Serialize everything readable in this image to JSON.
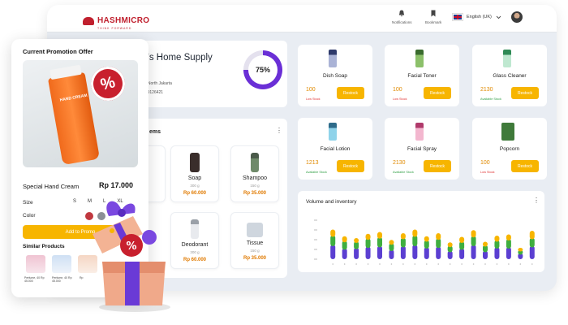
{
  "brand": {
    "name": "HASHMICRO",
    "tagline": "THINK FORWARD"
  },
  "topbar": {
    "notifications_label": "Notifications",
    "bookmark_label": "Bookmark",
    "language": "English (UK)"
  },
  "store": {
    "title": "Retailer's Home Supply Store",
    "address": "Jl. Pegasan, North Jakarta",
    "total_stock": "Total Stock : 9126421",
    "progress_label": "75%",
    "progress_fraction": 0.75,
    "ring_color": "#6a2fd6"
  },
  "products_panel": {
    "heading": "ems",
    "items": [
      {
        "name": "",
        "weight": "",
        "price": ""
      },
      {
        "name": "Soap",
        "weight": "300 g",
        "price": "Rp 60.000"
      },
      {
        "name": "Shampoo",
        "weight": "150 g",
        "price": "Rp 35.000"
      },
      {
        "name": "",
        "weight": "",
        "price": ""
      },
      {
        "name": "Deodorant",
        "weight": "300 g",
        "price": "Rp 60.000"
      },
      {
        "name": "Tissue",
        "weight": "150 g",
        "price": "Rp 35.000"
      }
    ]
  },
  "stock_tiles": [
    {
      "name": "Dish Soap",
      "count": "100",
      "status": "Low Stock",
      "status_color": "#e03131",
      "action": "Restock"
    },
    {
      "name": "Facial Toner",
      "count": "100",
      "status": "Low Stock",
      "status_color": "#e03131",
      "action": "Restock"
    },
    {
      "name": "Glass Cleaner",
      "count": "2130",
      "status": "Available Stock",
      "status_color": "#2f9e44",
      "action": "Restock"
    },
    {
      "name": "Facial Lotion",
      "count": "1213",
      "status": "Available Stock",
      "status_color": "#2f9e44",
      "action": "Restock"
    },
    {
      "name": "Facial Spray",
      "count": "2130",
      "status": "Available Stock",
      "status_color": "#2f9e44",
      "action": "Restock"
    },
    {
      "name": "Popcorn",
      "count": "100",
      "status": "Low Stock",
      "status_color": "#e03131",
      "action": "Restock"
    }
  ],
  "chart_data": {
    "type": "bar",
    "title": "Volume and inventory",
    "stacked": true,
    "colors": [
      "#5b3fd1",
      "#3fae3f",
      "#f7b500"
    ],
    "series": [
      {
        "values": [
          24,
          18,
          19,
          21,
          22,
          16,
          22,
          24,
          20,
          21,
          14,
          18,
          24,
          14,
          20,
          20,
          10,
          22
        ]
      },
      {
        "values": [
          18,
          15,
          13,
          16,
          17,
          13,
          16,
          18,
          14,
          16,
          11,
          14,
          17,
          12,
          14,
          16,
          8,
          16
        ]
      },
      {
        "values": [
          12,
          10,
          8,
          10,
          11,
          8,
          10,
          12,
          9,
          11,
          8,
          10,
          12,
          8,
          10,
          10,
          6,
          14
        ]
      }
    ]
  },
  "promo": {
    "title": "Current Promotion Offer",
    "badge": "%",
    "product_label": "HAND CREAM",
    "product_name": "Special Hand Cream",
    "price": "Rp 17.000",
    "size_label": "Size",
    "sizes": [
      "S",
      "M",
      "L",
      "XL"
    ],
    "color_label": "Color",
    "colors": [
      "#c0383f",
      "#8b8f96"
    ],
    "cta": "Add to Promo",
    "similar_title": "Similar Products",
    "similar_labels": [
      "Perfume, 40 Rp 45.000",
      "Perfume, 40 Rp 45.000",
      "Rp"
    ]
  },
  "gift_tag": "%"
}
